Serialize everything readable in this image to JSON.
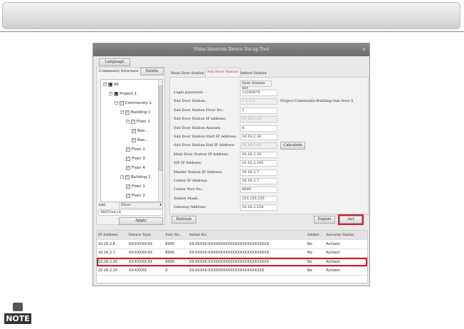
{
  "window": {
    "title": "Video Intercom Device Set-up Tool",
    "close": "×"
  },
  "language_button": "Language",
  "left": {
    "title": "Community Structure",
    "delete": "Delete",
    "tree": [
      {
        "label": "All",
        "depth": 0,
        "exp": true,
        "check": "■"
      },
      {
        "label": "Project 1",
        "depth": 1,
        "exp": true,
        "check": "■"
      },
      {
        "label": "Community 1",
        "depth": 2,
        "exp": true,
        "check": "✓"
      },
      {
        "label": "Building 1",
        "depth": 3,
        "exp": true,
        "check": "✓"
      },
      {
        "label": "Floor 1",
        "depth": 4,
        "exp": true,
        "check": "✓"
      },
      {
        "label": "Roo...",
        "depth": 5,
        "exp": false,
        "check": "✓"
      },
      {
        "label": "Roo...",
        "depth": 5,
        "exp": false,
        "check": "✓"
      },
      {
        "label": "Floor 2",
        "depth": 4,
        "exp": false,
        "check": "✓"
      },
      {
        "label": "Floor 3",
        "depth": 4,
        "exp": false,
        "check": "✓"
      },
      {
        "label": "Floor 4",
        "depth": 4,
        "exp": false,
        "check": "✓"
      },
      {
        "label": "Building 2",
        "depth": 3,
        "exp": true,
        "check": "✓"
      },
      {
        "label": "Floor 1",
        "depth": 4,
        "exp": false,
        "check": "✓"
      },
      {
        "label": "Floor 2",
        "depth": 4,
        "exp": false,
        "check": "✓"
      }
    ],
    "add_label": "Add",
    "add_select": "Floor",
    "all_floor": "All(Floor):4",
    "apply": "Apply"
  },
  "tabs": [
    "Main Door Station",
    "Sub Door Station",
    "Indoor Station"
  ],
  "active_tab": 1,
  "device_type_select": "Door Station Ser",
  "fields": [
    {
      "label": "Login password:",
      "value": "12345678",
      "disabled": false
    },
    {
      "label": "Sub Door Station:",
      "value": "1-1-1-1",
      "disabled": true,
      "note": "Project-Community-Building-Sub Door S"
    },
    {
      "label": "Sub Door Station Floor No.:",
      "value": "1",
      "disabled": false
    },
    {
      "label": "Sub Door Station IP address:",
      "value": "10.16.2.26",
      "disabled": true
    },
    {
      "label": "Sub Door Station Amount:",
      "value": "8",
      "disabled": false
    },
    {
      "label": "Sub Door Station Start IP Address:",
      "value": "10.16.2.26",
      "disabled": false
    },
    {
      "label": "Sub Door Station End IP Address:",
      "value": "10.16.2.41",
      "disabled": true,
      "button": "Calculate"
    },
    {
      "label": "Main Door Station IP Address:",
      "value": "10.16.2.10",
      "disabled": false
    },
    {
      "label": "SIP IP Address:",
      "value": "10.16.2.105",
      "disabled": false
    },
    {
      "label": "Master Station IP Address:",
      "value": "10.16.2.7",
      "disabled": false
    },
    {
      "label": "Center IP Address:",
      "value": "10.16.2.7",
      "disabled": false
    },
    {
      "label": "Center Port No.:",
      "value": "8000",
      "disabled": false
    },
    {
      "label": "Subnet Mask:",
      "value": "255.255.255",
      "disabled": false
    },
    {
      "label": "Gateway Address:",
      "value": "10.16.2.254",
      "disabled": false
    }
  ],
  "buttons": {
    "refresh": "Refresh",
    "export": "Export",
    "set": "Set"
  },
  "table": {
    "headers": [
      "IP Address",
      "Device Type",
      "Port No.",
      "Serial No.",
      "Added",
      "Security Status"
    ],
    "rows": [
      [
        "10.16.2.8",
        "XX-XXXXX-XX",
        "8000",
        "XX-XXXXX-XXXXXXXXXXXXXXXXXXXXXXXXX",
        "No",
        "Actived"
      ],
      [
        "10.16.2.7",
        "XX-XXXXX-XX",
        "8000",
        "XX-XXXXX-XXXXXXXXXXXXXXXXXXXXXXXXX",
        "No",
        "Actived"
      ],
      [
        "10.16.2.26",
        "XX-XXXXX-XX",
        "8000",
        "XX-XXXXX-XXXXXXXXXXXXXXXXXXXXXXXXX",
        "No",
        "Actived"
      ],
      [
        "10.16.2.15",
        "XX-XXXXX",
        "0",
        "XX-XXXXX-XXXXXXXXXXXXXXXXXXXXXXX",
        "No",
        "Actived"
      ]
    ],
    "selected_row": 2
  },
  "note_icon": "NOTE",
  "colors": {
    "highlight": "#c8202a"
  }
}
